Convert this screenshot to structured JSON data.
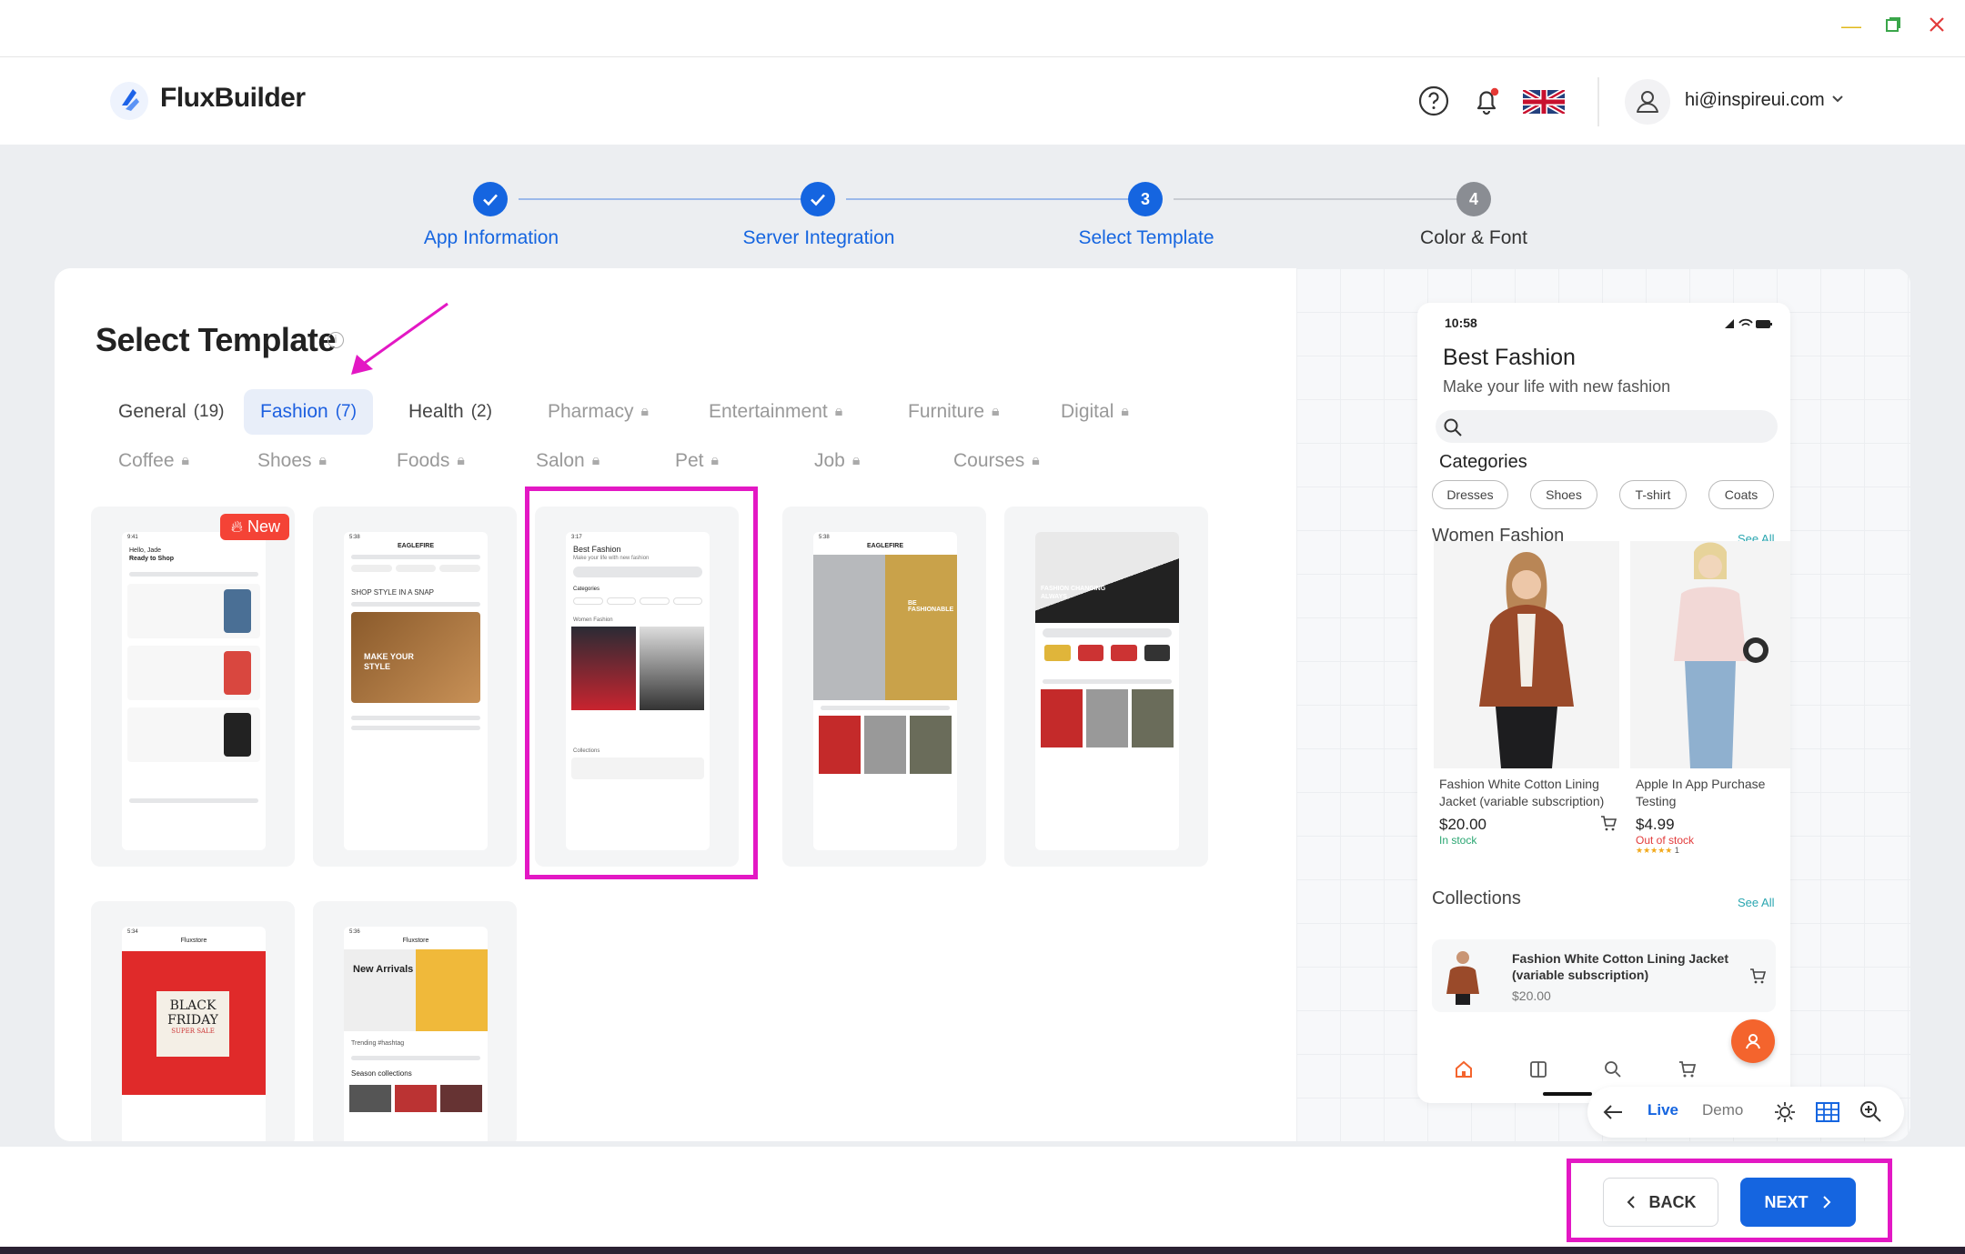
{
  "header": {
    "app_name": "FluxBuilder",
    "email": "hi@inspireui.com"
  },
  "stepper": [
    {
      "label": "App Information",
      "state": "done"
    },
    {
      "label": "Server Integration",
      "state": "done"
    },
    {
      "label": "Select Template",
      "state": "active",
      "num": "3"
    },
    {
      "label": "Color & Font",
      "state": "pending",
      "num": "4"
    }
  ],
  "main": {
    "title": "Select Template",
    "categories": [
      {
        "name": "General",
        "count": "(19)"
      },
      {
        "name": "Fashion",
        "count": "(7)"
      },
      {
        "name": "Health",
        "count": "(2)"
      },
      {
        "name": "Pharmacy"
      },
      {
        "name": "Entertainment"
      },
      {
        "name": "Furniture"
      },
      {
        "name": "Digital"
      },
      {
        "name": "Coffee"
      },
      {
        "name": "Shoes"
      },
      {
        "name": "Foods"
      },
      {
        "name": "Salon"
      },
      {
        "name": "Pet"
      },
      {
        "name": "Job"
      },
      {
        "name": "Courses"
      }
    ],
    "new_badge": "New",
    "thumbs": {
      "t1_greet": "Hello, Jade",
      "t1_sub": "Ready to Shop",
      "t2_brand": "EAGLEFIRE",
      "t2_snap": "SHOP STYLE IN A SNAP",
      "t2_make": "MAKE YOUR STYLE",
      "t3_title": "Best Fashion",
      "t3_sub": "Make your life with new fashion",
      "t3_cat": "Categories",
      "t3_women": "Women Fashion",
      "t3_coll": "Collections",
      "t4_brand": "EAGLEFIRE",
      "t4_banner": "BE FASHIONABLE",
      "t5_banner": "FASHION CHANGING ALWAYS",
      "t6_store": "Fluxstore",
      "t6_black": "BLACK FRIDAY",
      "t6_sale": "SUPER SALE",
      "t7_store": "Fluxstore",
      "t7_new": "New Arrivals",
      "t7_trend": "Trending #hashtag",
      "t7_season": "Season collections"
    }
  },
  "preview": {
    "time": "10:58",
    "title": "Best Fashion",
    "subtitle": "Make your life with new fashion",
    "categories_label": "Categories",
    "chips": [
      "Dresses",
      "Shoes",
      "T-shirt",
      "Coats"
    ],
    "women_label": "Women Fashion",
    "see_all": "See All",
    "products": [
      {
        "name": "Fashion White Cotton Lining Jacket (variable subscription)",
        "price": "$20.00",
        "stock": "In stock"
      },
      {
        "name": "Apple In App Purchase Testing",
        "price": "$4.99",
        "stock": "Out of stock",
        "rating": "1"
      }
    ],
    "collections_label": "Collections",
    "collection_item": {
      "name": "Fashion White Cotton Lining Jacket (variable subscription)",
      "price": "$20.00"
    },
    "toolbar": {
      "live": "Live",
      "demo": "Demo"
    }
  },
  "footer": {
    "back": "BACK",
    "next": "NEXT"
  },
  "colors": {
    "accent": "#1565e0",
    "highlight": "#e318c4",
    "fab": "#f4642d"
  }
}
